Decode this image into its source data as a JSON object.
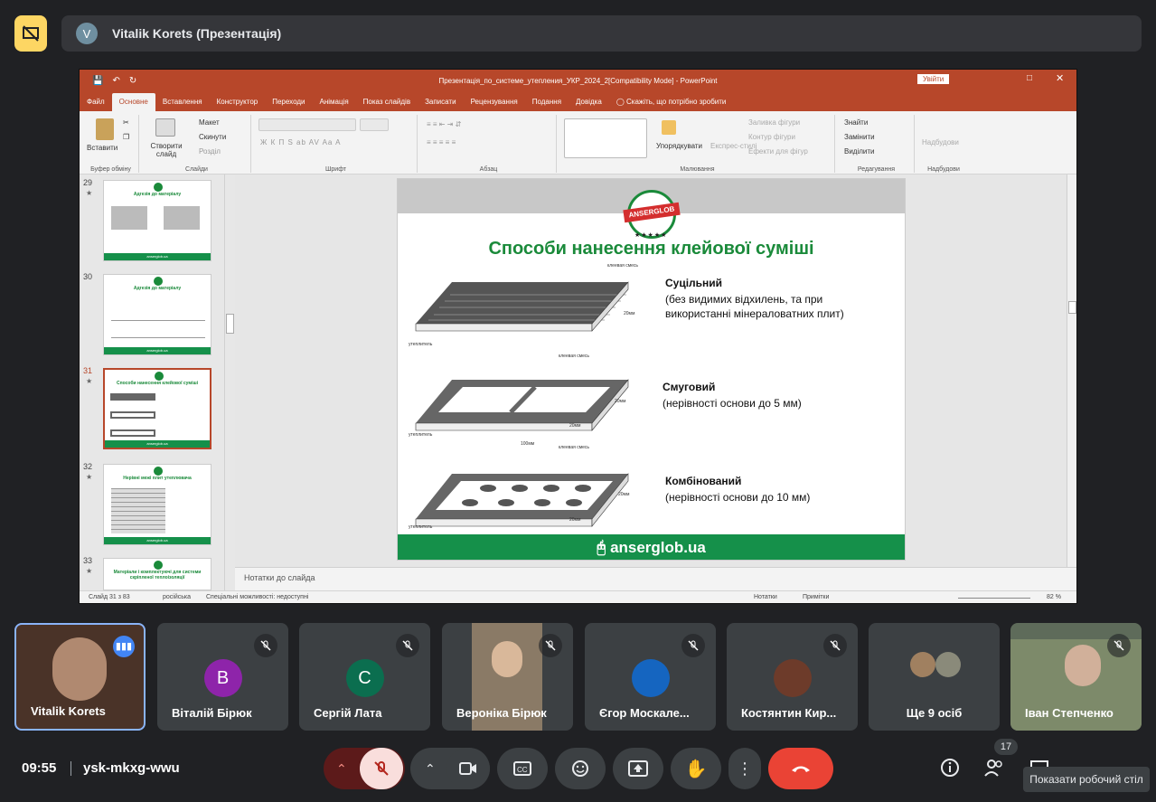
{
  "presenter": {
    "avatar_letter": "V",
    "name": "Vitalik Korets (Презентація)"
  },
  "ppt": {
    "title": "Презентація_по_системе_утепления_УКР_2024_2[Compatibility Mode]  -  PowerPoint",
    "signin": "Увійти",
    "tabs": [
      "Файл",
      "Основне",
      "Вставлення",
      "Конструктор",
      "Переходи",
      "Анімація",
      "Показ слайдів",
      "Записати",
      "Рецензування",
      "Подання",
      "Довідка"
    ],
    "tell_me": "Скажіть, що потрібно зробити",
    "ribbon": {
      "paste": "Вставити",
      "clipboard": "Буфер обміну",
      "new_slide": "Створити слайд",
      "layout": "Макет",
      "reset": "Скинути",
      "section": "Розділ",
      "slides": "Слайди",
      "font": "Шрифт",
      "font_buttons": "Ж  К  П  S  ab  AV  Aa  A",
      "paragraph": "Абзац",
      "arrange": "Упорядкувати",
      "quick_styles": "Експрес-стилі",
      "shape_fill": "Заливка фігури",
      "shape_outline": "Контур фігури",
      "shape_effects": "Ефекти для фігур",
      "drawing": "Малювання",
      "find": "Знайти",
      "replace": "Замінити",
      "select": "Виділити",
      "editing": "Редагування",
      "addins": "Надбудови",
      "addins_group": "Надбудови"
    },
    "thumbs": [
      {
        "num": "29",
        "title": "Адгезія до матеріалу"
      },
      {
        "num": "30",
        "title": "Адгезія до матеріалу"
      },
      {
        "num": "31",
        "title": "Способи нанесення клейової суміші"
      },
      {
        "num": "32",
        "title": "Нерівні межі плит утеплювача"
      },
      {
        "num": "33",
        "title": "Матеріали і комплектуючі для системи скріпленої теплоізоляції"
      }
    ],
    "slide": {
      "logo": "ANSERGLOB",
      "stars": "★★★★★",
      "title": "Способи нанесення клейової суміші",
      "methods": [
        {
          "name": "Суцільний",
          "desc": "(без видимих відхилень, та при використанні мінераловатних плит)"
        },
        {
          "name": "Смуговий",
          "desc": "(нерівності основи до 5 мм)"
        },
        {
          "name": "Комбінований",
          "desc": "(нерівності основи до 10 мм)"
        }
      ],
      "diagram_labels": {
        "glue": "клеевая смесь",
        "insul": "утеплитель",
        "mm20": "20мм",
        "mm100": "100мм"
      },
      "footer": "anserglob.ua"
    },
    "notes": "Нотатки до слайда",
    "status": {
      "slide": "Слайд 31 з 83",
      "lang": "російська",
      "access": "Спеціальні можливості: недоступні",
      "notes": "Нотатки",
      "comments": "Примітки",
      "zoom": "82 %"
    }
  },
  "tiles": [
    {
      "name": "Vitalik Korets",
      "letter": "",
      "color": "#5a3a2a"
    },
    {
      "name": "Віталій Бірюк",
      "letter": "В",
      "color": "#8e24aa"
    },
    {
      "name": "Сергій Лата",
      "letter": "С",
      "color": "#0b6e4f"
    },
    {
      "name": "Вероніка Бірюк",
      "letter": "",
      "color": "#7a6a5a"
    },
    {
      "name": "Єгор Москале...",
      "letter": "",
      "color": "#1565c0"
    },
    {
      "name": "Костянтин Кир...",
      "letter": "",
      "color": "#4e342e"
    },
    {
      "name": "Ще 9 осіб",
      "letter": "",
      "color": "#3c4043"
    },
    {
      "name": "Іван Степченко",
      "letter": "",
      "color": "#6b7a6a"
    }
  ],
  "bottom": {
    "time": "09:55",
    "code": "ysk-mkxg-wwu",
    "participants_count": "17",
    "tooltip": "Показати робочий стіл"
  }
}
